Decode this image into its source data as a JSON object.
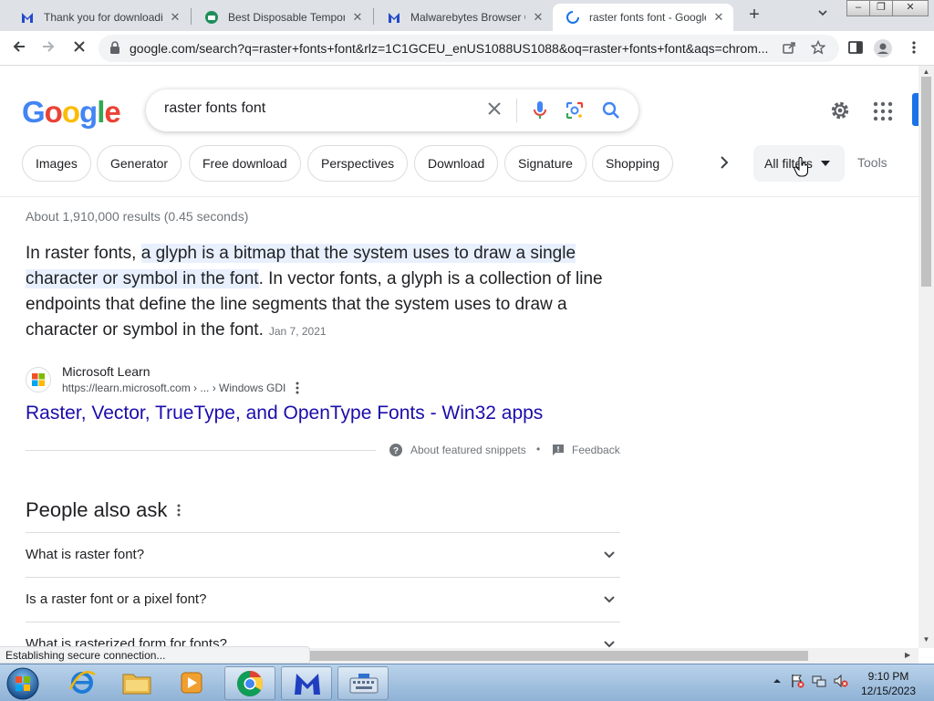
{
  "browser": {
    "tabs": [
      {
        "title": "Thank you for downloading",
        "favicon": "malwarebytes-icon"
      },
      {
        "title": "Best Disposable Temporary",
        "favicon": "site-green-icon"
      },
      {
        "title": "Malwarebytes Browser Guard",
        "favicon": "malwarebytes-icon"
      },
      {
        "title": "raster fonts font - Google",
        "favicon": "loading-spinner-icon",
        "active": true
      }
    ],
    "new_tab": "+",
    "url": "google.com/search?q=raster+fonts+font&rlz=1C1GCEU_enUS1088US1088&oq=raster+fonts+font&aqs=chrom...",
    "status_text": "Establishing secure connection..."
  },
  "search": {
    "query": "raster fonts font",
    "chips": [
      "Images",
      "Generator",
      "Free download",
      "Perspectives",
      "Download",
      "Signature",
      "Shopping"
    ],
    "all_filters": "All filters",
    "tools": "Tools"
  },
  "results": {
    "stats": "About 1,910,000 results (0.45 seconds)",
    "snippet": {
      "pre": "In raster fonts, ",
      "highlight": "a glyph is a bitmap that the system uses to draw a single character or symbol in the font",
      "post": ". In vector fonts, a glyph is a collection of line endpoints that define the line segments that the system uses to draw a character or symbol in the font.",
      "date": "Jan 7, 2021"
    },
    "source": {
      "name": "Microsoft Learn",
      "url": "https://learn.microsoft.com › ... › Windows GDI"
    },
    "title": "Raster, Vector, TrueType, and OpenType Fonts - Win32 apps",
    "about_snippets": "About featured snippets",
    "feedback": "Feedback"
  },
  "people_also_ask": {
    "title": "People also ask",
    "questions": [
      "What is raster font?",
      "Is a raster font or a pixel font?",
      "What is rasterized form for fonts?"
    ]
  },
  "taskbar": {
    "time": "9:10 PM",
    "date": "12/15/2023"
  },
  "colors": {
    "link": "#1a0dab",
    "highlight": "#e8f0fe",
    "accent_blue": "#1a73e8"
  }
}
